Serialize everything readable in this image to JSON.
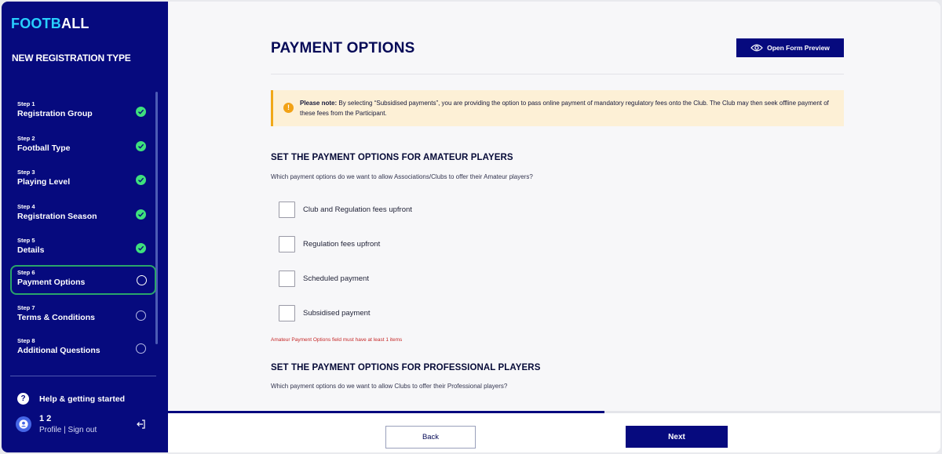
{
  "brand": {
    "part1": "FOOTB",
    "part2": "ALL"
  },
  "sidebar": {
    "title": "NEW REGISTRATION TYPE",
    "steps": [
      {
        "num": "Step 1",
        "label": "Registration Group",
        "status": "complete"
      },
      {
        "num": "Step 2",
        "label": "Football Type",
        "status": "complete"
      },
      {
        "num": "Step 3",
        "label": "Playing Level",
        "status": "complete"
      },
      {
        "num": "Step 4",
        "label": "Registration Season",
        "status": "complete"
      },
      {
        "num": "Step 5",
        "label": "Details",
        "status": "complete"
      },
      {
        "num": "Step 6",
        "label": "Payment Options",
        "status": "current"
      },
      {
        "num": "Step 7",
        "label": "Terms & Conditions",
        "status": "pending"
      },
      {
        "num": "Step 8",
        "label": "Additional Questions",
        "status": "pending"
      }
    ],
    "help_label": "Help & getting started",
    "help_icon": "?",
    "user": {
      "name": "1 2",
      "profile": "Profile",
      "separator": "|",
      "signout": "Sign out"
    }
  },
  "main": {
    "title": "PAYMENT OPTIONS",
    "preview_button": "Open Form Preview",
    "note": {
      "icon": "!",
      "label": "Please note:",
      "text": "By selecting “Subsidised payments”, you are providing the option to pass online payment of mandatory regulatory fees onto the Club. The Club may then seek offline payment of these fees from the Participant."
    },
    "amateur": {
      "title": "SET THE PAYMENT OPTIONS FOR AMATEUR PLAYERS",
      "question": "Which payment options do we want to allow Associations/Clubs to offer their Amateur players?",
      "options": [
        "Club and Regulation fees upfront",
        "Regulation fees upfront",
        "Scheduled payment",
        "Subsidised payment"
      ],
      "error": "Amateur Payment Options field must have at least 1 items"
    },
    "professional": {
      "title": "SET THE PAYMENT OPTIONS FOR PROFESSIONAL PLAYERS",
      "question": "Which payment options do we want to allow Clubs to offer their Professional players?"
    }
  },
  "footer": {
    "progress_fraction": 0.565,
    "back_label": "Back",
    "next_label": "Next"
  },
  "colors": {
    "sidebar_bg": "#060a7e",
    "brand_accent": "#28d0ff",
    "complete": "#3ee07d",
    "active_outline": "#2aa56a",
    "warning": "#f2a216",
    "error": "#c62828"
  }
}
